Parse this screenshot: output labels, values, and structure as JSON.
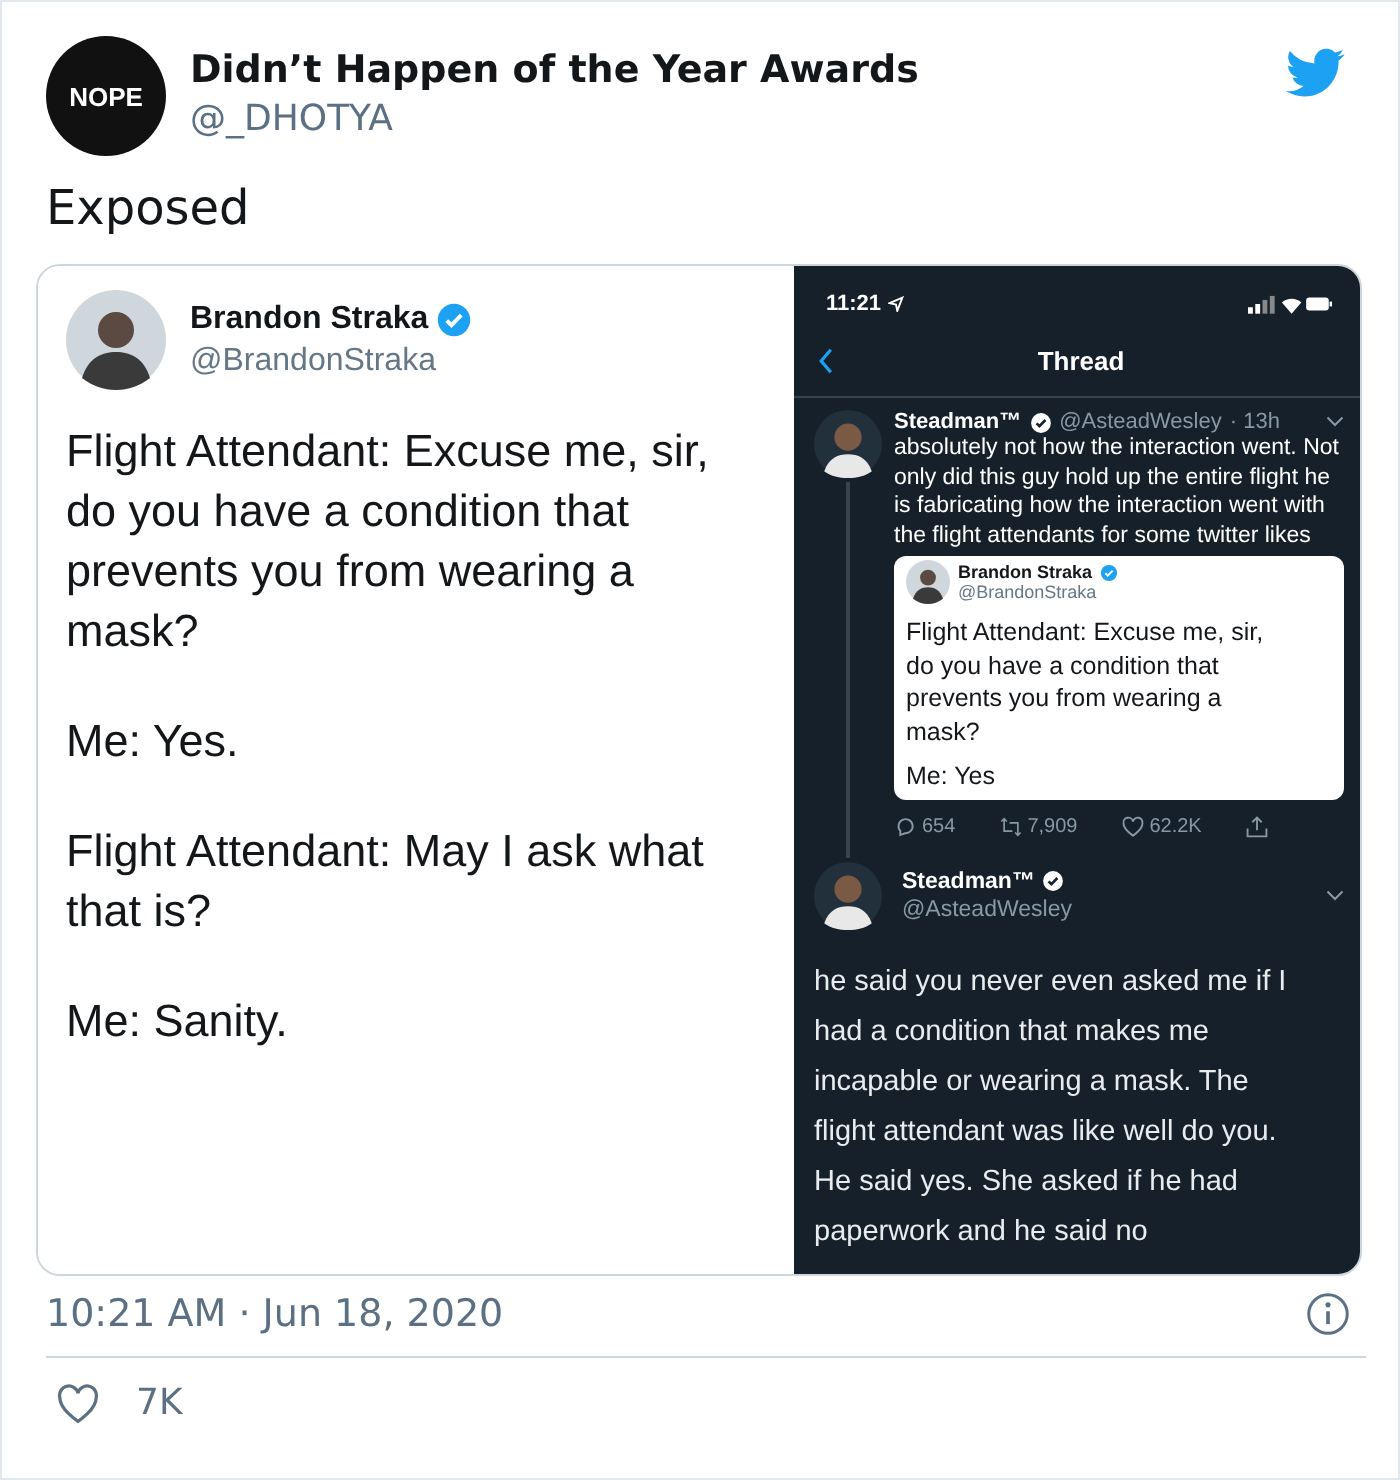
{
  "tweet": {
    "avatar_text": "NOPE",
    "name": "Didn’t Happen of the Year Awards",
    "handle": "@_DHOTYA",
    "text": "Exposed",
    "timestamp": "10:21 AM · Jun 18, 2020",
    "likes": "7K"
  },
  "left_screenshot": {
    "name": "Brandon Straka",
    "verified": true,
    "handle": "@BrandonStraka",
    "paragraphs": [
      "Flight Attendant: Excuse me, sir, do you have a condition that prevents you from wearing a mask?",
      "Me: Yes.",
      "Flight Attendant: May I ask what that is?",
      "Me: Sanity."
    ]
  },
  "right_screenshot": {
    "status_time": "11:21",
    "title": "Thread",
    "thread": [
      {
        "kind": "quote_tweet",
        "name": "Steadman™",
        "verified": true,
        "handle": "@AsteadWesley",
        "time": "· 13h",
        "text": "absolutely not how the interaction went. Not only did this guy hold up the entire flight he is fabricating how the interaction went with the flight attendants for some twitter likes",
        "quote": {
          "name": "Brandon Straka",
          "verified": true,
          "handle": "@BrandonStraka",
          "lines": [
            "Flight Attendant: Excuse me, sir, do you have a condition that prevents you from wearing a mask?",
            "Me: Yes"
          ]
        },
        "replies": "654",
        "retweets": "7,909",
        "likes": "62.2K"
      },
      {
        "kind": "focused_tweet",
        "name": "Steadman™",
        "verified": true,
        "handle": "@AsteadWesley",
        "text": "he said you never even asked me if I had a condition that makes me incapable or wearing a mask. The flight attendant was like well do you. He said yes. She asked if he had paperwork and he said no"
      }
    ]
  }
}
